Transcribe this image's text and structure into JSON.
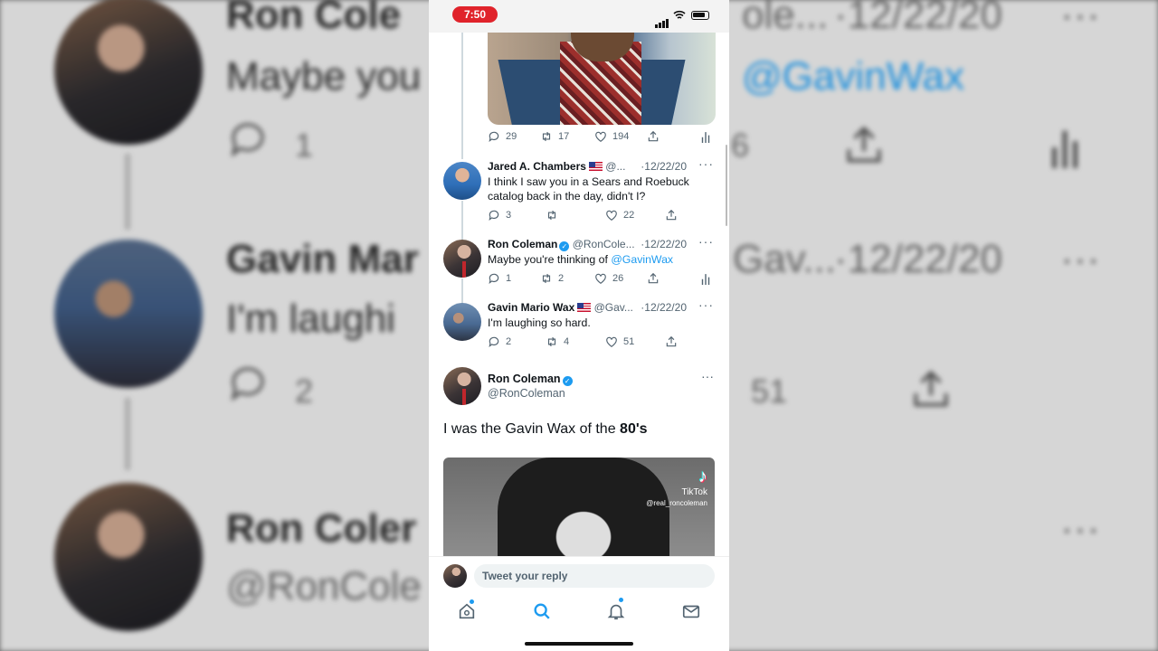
{
  "status_bar": {
    "time": "7:50"
  },
  "background": {
    "row1": {
      "name": "Ron Cole",
      "name_suffix": "ole...",
      "date": "·12/22/20",
      "more": "···",
      "body_left": "Maybe you",
      "body_right": "@GavinWax",
      "reply_count": "1",
      "like_partial": "6"
    },
    "row2": {
      "name": "Gavin Mar",
      "name_suffix": "Gav...",
      "date": "·12/22/20",
      "more": "···",
      "body_left": "I'm laughi",
      "reply_count": "2",
      "like_count": "51"
    },
    "row3": {
      "name": "Ron Coler",
      "handle": "@RonCole",
      "more": "···"
    }
  },
  "previous_tweet_actions": {
    "replies": "29",
    "retweets": "17",
    "likes": "194"
  },
  "tweets": [
    {
      "name": "Jared A. Chambers",
      "handle": "@...",
      "date": "·12/22/20",
      "more": "···",
      "text": "I think I saw you in a Sears and Roebuck catalog back in the day, didn't I?",
      "replies": "3",
      "retweets": "",
      "likes": "22"
    },
    {
      "name": "Ron Coleman",
      "handle": "@RonCole...",
      "date": "·12/22/20",
      "more": "···",
      "text_prefix": "Maybe you're thinking of ",
      "mention": "@GavinWax",
      "replies": "1",
      "retweets": "2",
      "likes": "26"
    },
    {
      "name": "Gavin Mario Wax",
      "handle": "@Gav...",
      "date": "·12/22/20",
      "more": "···",
      "text": "I'm laughing so hard.",
      "replies": "2",
      "retweets": "4",
      "likes": "51"
    }
  ],
  "main_tweet": {
    "name": "Ron Coleman",
    "handle": "@RonColeman",
    "more": "···",
    "text_prefix": "I was the Gavin Wax of the ",
    "text_bold": "80's"
  },
  "video_watermark": {
    "logo": "♪",
    "brand": "TikTok",
    "user": "@real_roncoleman"
  },
  "reply_bar": {
    "placeholder": "Tweet your reply"
  },
  "tabs": [
    "home",
    "search",
    "notifications",
    "messages"
  ],
  "colors": {
    "accent": "#1d9bf0",
    "time_pill": "#e0232b"
  }
}
